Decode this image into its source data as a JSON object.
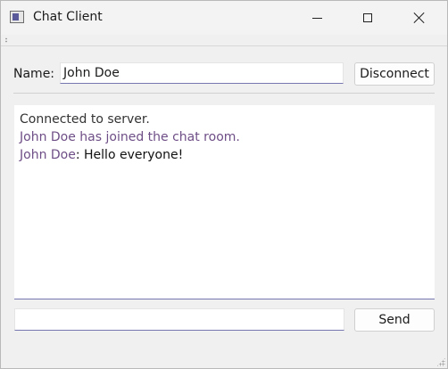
{
  "window": {
    "title": "Chat Client",
    "accent": "#7676b0"
  },
  "titlebar": {
    "icon": "app-window-icon",
    "minimize_icon": "minimize-icon",
    "maximize_icon": "maximize-icon",
    "close_icon": "close-icon"
  },
  "connection": {
    "name_label": "Name:",
    "name_value": "John Doe",
    "disconnect_label": "Disconnect"
  },
  "chat": {
    "messages": [
      {
        "kind": "system",
        "text": "Connected to server."
      },
      {
        "kind": "join",
        "text": "John Doe has joined the chat room."
      },
      {
        "kind": "user",
        "user": "John Doe",
        "separator": ": ",
        "text": "Hello everyone!"
      }
    ]
  },
  "composer": {
    "message_value": "",
    "send_label": "Send"
  }
}
